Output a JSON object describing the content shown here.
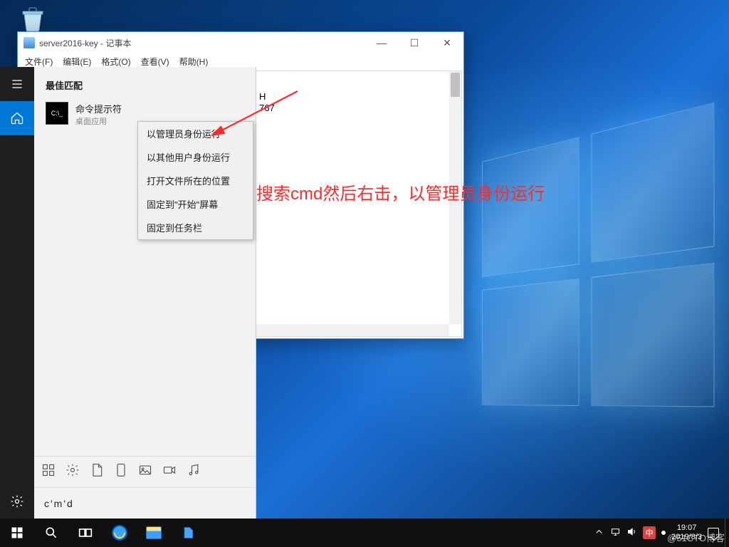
{
  "desktop": {
    "recycle_label": "回收站"
  },
  "notepad": {
    "title": "server2016-key - 记事本",
    "menu": [
      "文件(F)",
      "编辑(E)",
      "格式(O)",
      "查看(V)",
      "帮助(H)"
    ],
    "body_fragments": {
      "line1_tail": "H",
      "line2_tail": "767"
    }
  },
  "start_rail": {
    "menu": "menu-icon",
    "home": "home-icon",
    "settings": "gear-icon"
  },
  "search": {
    "header": "最佳匹配",
    "item": {
      "title": "命令提示符",
      "subtitle": "桌面应用"
    },
    "context_menu": [
      "以管理员身份运行",
      "以其他用户身份运行",
      "打开文件所在的位置",
      "固定到\"开始\"屏幕",
      "固定到任务栏"
    ],
    "filters": [
      "apps-icon",
      "gear-icon",
      "document-icon",
      "tablet-icon",
      "image-icon",
      "video-icon",
      "music-icon"
    ],
    "query": "c'm'd"
  },
  "taskbar": {
    "items": [
      "start",
      "search",
      "task-view",
      "ie",
      "explorer",
      "app"
    ],
    "tray": {
      "ime": "中",
      "time": "19:07",
      "date": "2019/8/3"
    }
  },
  "annotation": {
    "text": "搜索cmd然后右击，以管理员身份运行"
  },
  "watermark": "@51CTO博客"
}
